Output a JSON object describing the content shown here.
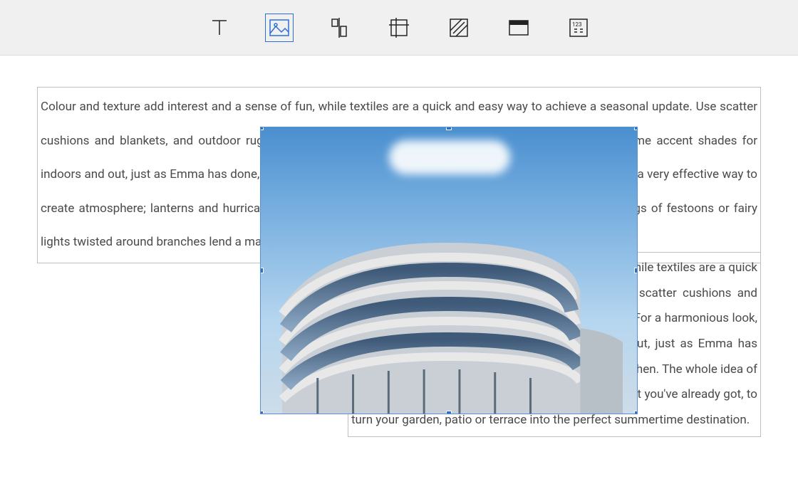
{
  "toolbar": {
    "tools": [
      {
        "name": "text",
        "label": "Text"
      },
      {
        "name": "image",
        "label": "Image"
      },
      {
        "name": "align",
        "label": "Align"
      },
      {
        "name": "crop",
        "label": "Crop"
      },
      {
        "name": "texture",
        "label": "Texture"
      },
      {
        "name": "frame",
        "label": "Frame"
      },
      {
        "name": "numbering",
        "label": "Numbering"
      }
    ],
    "active": "image"
  },
  "document": {
    "textBlock1": "Colour and texture add interest and a sense of fun, while textiles are a quick and easy way to achieve a seasonal update. Use scatter cushions and blankets, and outdoor rugs to help define the space. For a harmonious look, choose the same accent shades for indoors and out, just as Emma has done, carrying the purple and lime tones onto her kitchen. Finally, lighting is a very effective way to create atmosphere; lanterns and hurricane lamps are one option and come in  a variety of styles, while strings of festoons or fairy lights twisted around branches lend a magic glow.",
    "textBlock2": "Colour and texture add interest and a sense of fun, while textiles are a quick and easy way to achieve a seasonal update. Use scatter cushions and blankets, and outdoor rugs to help define the space. For a harmonious look, choose the same accent shades for indoors and out, just as Emma has done, carrying the purple and lime tones onto her kitchen. The whole idea of getting your home summer-ready is to maximise what you've already got, to turn your garden, patio or terrace into the perfect summertime destination."
  },
  "image": {
    "alt": "Modern curved office building against blue sky"
  }
}
